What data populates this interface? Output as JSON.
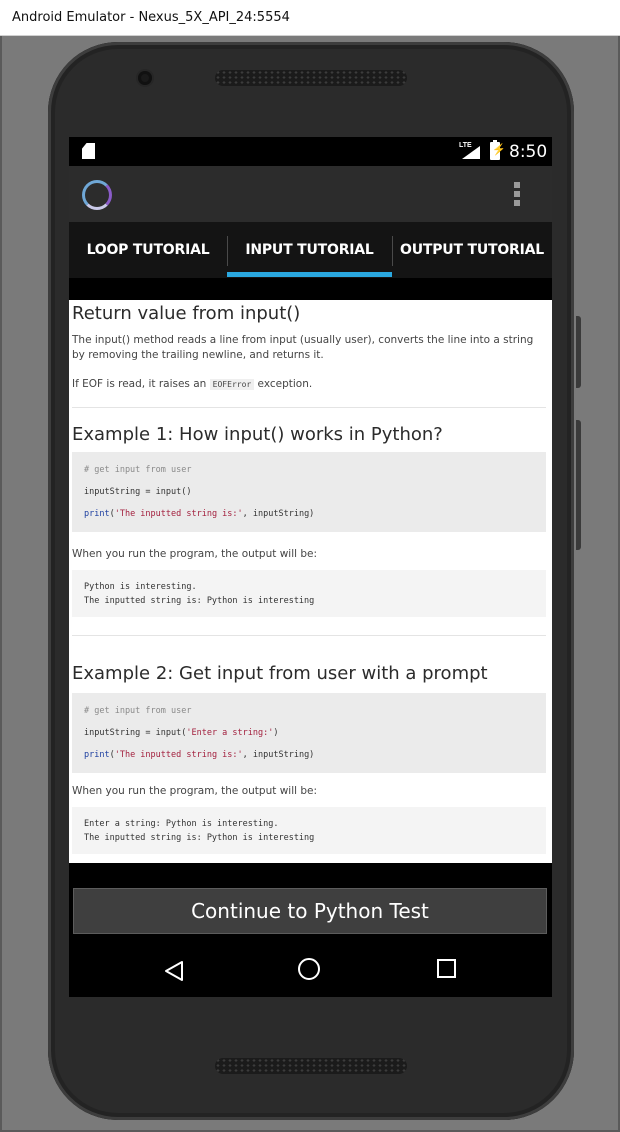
{
  "window": {
    "title": "Android Emulator - Nexus_5X_API_24:5554"
  },
  "status_bar": {
    "network": "LTE",
    "time": "8:50"
  },
  "tabs": [
    {
      "label": "LOOP TUTORIAL"
    },
    {
      "label": "INPUT TUTORIAL",
      "active": true
    },
    {
      "label": "OUTPUT TUTORIAL"
    }
  ],
  "accent_color": "#2aa8e0",
  "content": {
    "section1": {
      "title": "Return value from input()",
      "para1": "The input() method reads a line from input (usually user), converts the line into a string by removing the trailing newline, and returns it.",
      "para2_before": "If EOF is read, it raises an ",
      "para2_code": "EOFError",
      "para2_after": " exception."
    },
    "example1": {
      "title": "Example 1: How input() works in Python?",
      "code_comment": "# get input from user",
      "code_line1": "inputString = input()",
      "code_line2_kw": "print",
      "code_line2_str": "'The inputted string is:'",
      "code_line2_rest": ", inputString)",
      "run_text": "When you run the program, the output will be:",
      "output_line1": "Python is interesting.",
      "output_line2": "The inputted string is: Python is interesting"
    },
    "example2": {
      "title": "Example 2: Get input from user with a prompt",
      "code_comment": "# get input from user",
      "code_line1_pre": "inputString = input(",
      "code_line1_str": "'Enter a string:'",
      "code_line1_post": ")",
      "code_line2_kw": "print",
      "code_line2_str": "'The inputted string is:'",
      "code_line2_rest": ", inputString)",
      "run_text": "When you run the program, the output will be:",
      "output_line1": "Enter a string: Python is interesting.",
      "output_line2": "The inputted string is: Python is interesting"
    }
  },
  "footer": {
    "button_label": "Continue to Python Test"
  },
  "nav_bar": {
    "icons": [
      "back-icon",
      "home-icon",
      "recents-icon"
    ]
  }
}
